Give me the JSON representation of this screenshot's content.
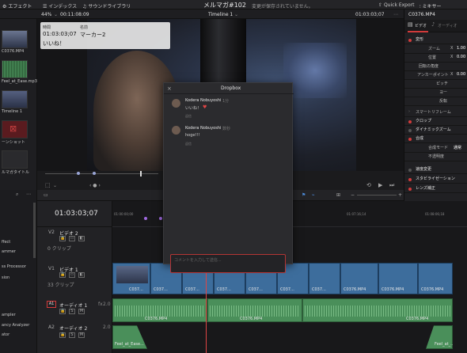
{
  "topbar": {
    "effects_label": "エフェクト",
    "index_label": "インデックス",
    "sound_library_label": "サウンドライブラリ",
    "project_title": "メルマガ#102",
    "unsaved_status": "変更が保存されていません。",
    "quick_export_label": "Quick Export",
    "mixer_label": "ミキサー"
  },
  "viewer_bar": {
    "zoom": "44%",
    "source_timecode": "00:11:08:09",
    "timeline_name": "Timeline 1",
    "current_timecode": "01:03:03;07",
    "clip_name": "C0376.MP4"
  },
  "marker_tooltip": {
    "time_header": "時間",
    "time_value": "01:03:03;07",
    "name_header": "名前",
    "name_value": "マーカー2",
    "note": "いいね！"
  },
  "media_pool": {
    "items": [
      {
        "label": "C0376.MP4"
      },
      {
        "label": "Feel_at_Ease.mp3"
      },
      {
        "label": "Timeline 1"
      },
      {
        "label": "ーンショット"
      },
      {
        "label": "ルマガタイトル"
      }
    ]
  },
  "dropbox": {
    "title": "Dropbox",
    "comments": [
      {
        "author": "Kodera Nobuyoshi",
        "age": "1分",
        "text": "いいね！",
        "reply_label": "返信"
      },
      {
        "author": "Kodera Nobuyoshi",
        "age": "数秒",
        "text": "hoge!!!",
        "reply_label": "返信"
      }
    ],
    "comment_placeholder": "コメントを入力して送信..."
  },
  "inspector": {
    "tabs": [
      {
        "label": "ビデオ"
      },
      {
        "label": "オーディオ"
      }
    ],
    "transform_label": "変形",
    "zoom_label": "ズーム",
    "zoom_axis": "X",
    "zoom_value": "1.00",
    "position_label": "位置",
    "position_axis": "X",
    "position_value": "0.00",
    "rotation_label": "回転の角度",
    "anchor_label": "アンカーポイント",
    "anchor_axis": "X",
    "anchor_value": "0.00",
    "pitch_label": "ピッチ",
    "yaw_label": "ヨー",
    "flip_label": "反転",
    "smart_reframe_label": "スマートリフレーム",
    "crop_label": "クロップ",
    "dynamic_zoom_label": "ダイナミックズーム",
    "composite_label": "合成",
    "composite_mode_label": "合成モード",
    "composite_mode_value": "通常",
    "opacity_label": "不透明度",
    "speed_change_label": "速度変更",
    "stabilization_label": "スタビライゼーション",
    "lens_label": "レンズ補正"
  },
  "timeline": {
    "timecode": "01:03:03;07",
    "ruler": [
      "01:00:00;00",
      "01:07:16;14",
      "01:08:06;18"
    ],
    "tracks": {
      "v2": {
        "id": "V2",
        "name": "ビデオ 2",
        "clips": "0 クリップ"
      },
      "v1": {
        "id": "V1",
        "name": "ビデオ 1",
        "clips": "33 クリップ"
      },
      "a1": {
        "id": "A1",
        "name": "オーディオ 1",
        "level": "2.0",
        "fx": "fx"
      },
      "a2": {
        "id": "A2",
        "name": "オーディオ 2",
        "level": "2.0"
      }
    },
    "video_clip_label": "C037...",
    "video_clip_label_full": "C0376.MP4",
    "audio_clip_label": "C0376.MP4",
    "audio2_clip_label": "Feel_at_Ease...",
    "audio2_clip_label_end": "Feel_at_..."
  },
  "left_panel_items": [
    {
      "label": "ffect"
    },
    {
      "label": "ammer"
    },
    {
      "label": "ss Processor"
    },
    {
      "label": "sion"
    },
    {
      "label": "ampler"
    },
    {
      "label": "ancy Analyzer"
    },
    {
      "label": "ator"
    }
  ],
  "colors": {
    "accent_red": "#d23a3a",
    "video_clip": "#3d6d9c",
    "audio_clip": "#4a8f5a",
    "playhead": "#e04545",
    "marker": "#a069e0"
  }
}
